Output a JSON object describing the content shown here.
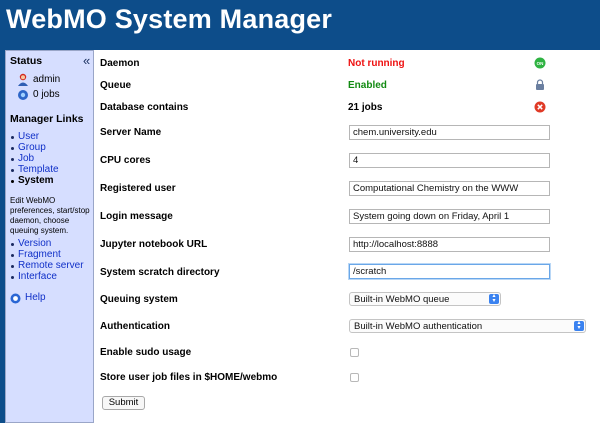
{
  "app": {
    "title": "WebMO System Manager"
  },
  "sidebar": {
    "status_title": "Status",
    "collapse_glyph": "«",
    "user": "admin",
    "jobs": "0 jobs",
    "links_title": "Manager Links",
    "links": [
      {
        "label": "User"
      },
      {
        "label": "Group"
      },
      {
        "label": "Job"
      },
      {
        "label": "Template"
      },
      {
        "label": "System"
      }
    ],
    "description": "Edit WebMO preferences, start/stop daemon, choose queuing system.",
    "links2": [
      {
        "label": "Version"
      },
      {
        "label": "Fragment"
      },
      {
        "label": "Remote server"
      },
      {
        "label": "Interface"
      }
    ],
    "help": "Help"
  },
  "main": {
    "daemon": {
      "label": "Daemon",
      "value": "Not running",
      "color": "#ee1111",
      "icon": "start-icon"
    },
    "queue": {
      "label": "Queue",
      "value": "Enabled",
      "color": "#128a12",
      "icon": "lock-icon"
    },
    "database": {
      "label": "Database contains",
      "value": "21 jobs",
      "color": "#000000",
      "icon": "delete-icon"
    },
    "server_name": {
      "label": "Server Name",
      "value": "chem.university.edu"
    },
    "cpu_cores": {
      "label": "CPU cores",
      "value": "4"
    },
    "registered_user": {
      "label": "Registered user",
      "value": "Computational Chemistry on the WWW"
    },
    "login_message": {
      "label": "Login message",
      "value": "System going down on Friday, April 1"
    },
    "jupyter_url": {
      "label": "Jupyter notebook URL",
      "value": "http://localhost:8888"
    },
    "scratch_dir": {
      "label": "System scratch directory",
      "value": "/scratch"
    },
    "queuing_system": {
      "label": "Queuing system",
      "value": "Built-in WebMO queue"
    },
    "authentication": {
      "label": "Authentication",
      "value": "Built-in WebMO authentication"
    },
    "sudo": {
      "label": "Enable sudo usage",
      "checked": false
    },
    "home_storage": {
      "label": "Store user job files in $HOME/webmo",
      "checked": false
    },
    "submit_label": "Submit"
  }
}
